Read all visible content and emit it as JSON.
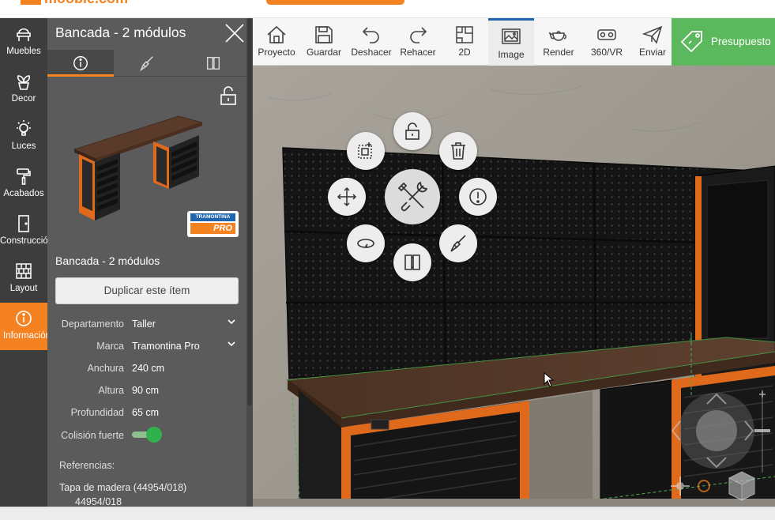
{
  "app": {
    "logo_text": "mooble.com"
  },
  "leftnav": {
    "items": [
      {
        "label": "Muebles",
        "icon": "chair-icon"
      },
      {
        "label": "Decor",
        "icon": "plant-icon"
      },
      {
        "label": "Luces",
        "icon": "lightbulb-icon"
      },
      {
        "label": "Acabados",
        "icon": "paint-roller-icon"
      },
      {
        "label": "Construcción",
        "icon": "door-icon"
      },
      {
        "label": "Layout",
        "icon": "brick-wall-icon"
      },
      {
        "label": "Información",
        "icon": "info-icon"
      }
    ],
    "active_index": 6
  },
  "panel": {
    "title": "Bancada - 2 módulos",
    "tabs": [
      "info-icon",
      "brush-icon",
      "door-swap-icon"
    ],
    "brand_logo": {
      "line1": "TRAMONTINA",
      "line2": "PRO"
    },
    "item_name": "Bancada - 2 módulos",
    "duplicate_label": "Duplicar este ítem",
    "properties": [
      {
        "label": "Departamento",
        "value": "Taller",
        "dropdown": true
      },
      {
        "label": "Marca",
        "value": "Tramontina Pro",
        "dropdown": true
      },
      {
        "label": "Anchura",
        "value": "240 cm"
      },
      {
        "label": "Altura",
        "value": "90 cm"
      },
      {
        "label": "Profundidad",
        "value": "65 cm"
      }
    ],
    "collision_label": "Colisión fuerte",
    "collision_on": true,
    "references_title": "Referencias:",
    "reference_line1": "Tapa de madera (44954/018)",
    "reference_line2": "44954/018"
  },
  "toolbar": {
    "items": [
      {
        "label": "Proyecto",
        "icon": "house-icon"
      },
      {
        "label": "Guardar",
        "icon": "save-icon"
      },
      {
        "label": "Deshacer",
        "icon": "undo-icon"
      },
      {
        "label": "Rehacer",
        "icon": "redo-icon"
      },
      {
        "label": "2D",
        "icon": "plan-2d-icon"
      },
      {
        "label": "Image",
        "icon": "image-icon"
      },
      {
        "label": "Render",
        "icon": "teapot-icon"
      },
      {
        "label": "360/VR",
        "icon": "vr-headset-icon"
      },
      {
        "label": "Enviar",
        "icon": "send-icon"
      }
    ],
    "active_index": 5,
    "budget_label": "Presupuesto",
    "budget_icon": "price-tag-icon"
  },
  "radial_menu": {
    "center": "tools-icon",
    "items": [
      "lock-open-icon",
      "trash-icon",
      "info-icon",
      "paint-brush-icon",
      "door-swap-icon",
      "rotate-icon",
      "move-icon",
      "group-icon"
    ]
  },
  "colors": {
    "accent": "#f58220",
    "nav_bg": "#3d3d3d",
    "panel_bg": "#5b5b5b",
    "budget_green": "#5cb85c",
    "toggle_green": "#2fb24b",
    "active_tab_blue": "#1f64ad"
  }
}
